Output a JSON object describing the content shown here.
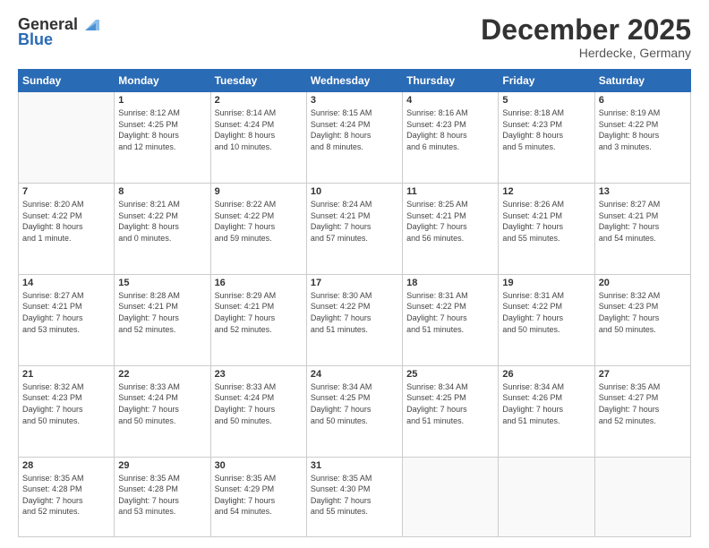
{
  "logo": {
    "general": "General",
    "blue": "Blue"
  },
  "header": {
    "month": "December 2025",
    "location": "Herdecke, Germany"
  },
  "weekdays": [
    "Sunday",
    "Monday",
    "Tuesday",
    "Wednesday",
    "Thursday",
    "Friday",
    "Saturday"
  ],
  "weeks": [
    [
      {
        "day": "",
        "info": ""
      },
      {
        "day": "1",
        "info": "Sunrise: 8:12 AM\nSunset: 4:25 PM\nDaylight: 8 hours\nand 12 minutes."
      },
      {
        "day": "2",
        "info": "Sunrise: 8:14 AM\nSunset: 4:24 PM\nDaylight: 8 hours\nand 10 minutes."
      },
      {
        "day": "3",
        "info": "Sunrise: 8:15 AM\nSunset: 4:24 PM\nDaylight: 8 hours\nand 8 minutes."
      },
      {
        "day": "4",
        "info": "Sunrise: 8:16 AM\nSunset: 4:23 PM\nDaylight: 8 hours\nand 6 minutes."
      },
      {
        "day": "5",
        "info": "Sunrise: 8:18 AM\nSunset: 4:23 PM\nDaylight: 8 hours\nand 5 minutes."
      },
      {
        "day": "6",
        "info": "Sunrise: 8:19 AM\nSunset: 4:22 PM\nDaylight: 8 hours\nand 3 minutes."
      }
    ],
    [
      {
        "day": "7",
        "info": "Sunrise: 8:20 AM\nSunset: 4:22 PM\nDaylight: 8 hours\nand 1 minute."
      },
      {
        "day": "8",
        "info": "Sunrise: 8:21 AM\nSunset: 4:22 PM\nDaylight: 8 hours\nand 0 minutes."
      },
      {
        "day": "9",
        "info": "Sunrise: 8:22 AM\nSunset: 4:22 PM\nDaylight: 7 hours\nand 59 minutes."
      },
      {
        "day": "10",
        "info": "Sunrise: 8:24 AM\nSunset: 4:21 PM\nDaylight: 7 hours\nand 57 minutes."
      },
      {
        "day": "11",
        "info": "Sunrise: 8:25 AM\nSunset: 4:21 PM\nDaylight: 7 hours\nand 56 minutes."
      },
      {
        "day": "12",
        "info": "Sunrise: 8:26 AM\nSunset: 4:21 PM\nDaylight: 7 hours\nand 55 minutes."
      },
      {
        "day": "13",
        "info": "Sunrise: 8:27 AM\nSunset: 4:21 PM\nDaylight: 7 hours\nand 54 minutes."
      }
    ],
    [
      {
        "day": "14",
        "info": "Sunrise: 8:27 AM\nSunset: 4:21 PM\nDaylight: 7 hours\nand 53 minutes."
      },
      {
        "day": "15",
        "info": "Sunrise: 8:28 AM\nSunset: 4:21 PM\nDaylight: 7 hours\nand 52 minutes."
      },
      {
        "day": "16",
        "info": "Sunrise: 8:29 AM\nSunset: 4:21 PM\nDaylight: 7 hours\nand 52 minutes."
      },
      {
        "day": "17",
        "info": "Sunrise: 8:30 AM\nSunset: 4:22 PM\nDaylight: 7 hours\nand 51 minutes."
      },
      {
        "day": "18",
        "info": "Sunrise: 8:31 AM\nSunset: 4:22 PM\nDaylight: 7 hours\nand 51 minutes."
      },
      {
        "day": "19",
        "info": "Sunrise: 8:31 AM\nSunset: 4:22 PM\nDaylight: 7 hours\nand 50 minutes."
      },
      {
        "day": "20",
        "info": "Sunrise: 8:32 AM\nSunset: 4:23 PM\nDaylight: 7 hours\nand 50 minutes."
      }
    ],
    [
      {
        "day": "21",
        "info": "Sunrise: 8:32 AM\nSunset: 4:23 PM\nDaylight: 7 hours\nand 50 minutes."
      },
      {
        "day": "22",
        "info": "Sunrise: 8:33 AM\nSunset: 4:24 PM\nDaylight: 7 hours\nand 50 minutes."
      },
      {
        "day": "23",
        "info": "Sunrise: 8:33 AM\nSunset: 4:24 PM\nDaylight: 7 hours\nand 50 minutes."
      },
      {
        "day": "24",
        "info": "Sunrise: 8:34 AM\nSunset: 4:25 PM\nDaylight: 7 hours\nand 50 minutes."
      },
      {
        "day": "25",
        "info": "Sunrise: 8:34 AM\nSunset: 4:25 PM\nDaylight: 7 hours\nand 51 minutes."
      },
      {
        "day": "26",
        "info": "Sunrise: 8:34 AM\nSunset: 4:26 PM\nDaylight: 7 hours\nand 51 minutes."
      },
      {
        "day": "27",
        "info": "Sunrise: 8:35 AM\nSunset: 4:27 PM\nDaylight: 7 hours\nand 52 minutes."
      }
    ],
    [
      {
        "day": "28",
        "info": "Sunrise: 8:35 AM\nSunset: 4:28 PM\nDaylight: 7 hours\nand 52 minutes."
      },
      {
        "day": "29",
        "info": "Sunrise: 8:35 AM\nSunset: 4:28 PM\nDaylight: 7 hours\nand 53 minutes."
      },
      {
        "day": "30",
        "info": "Sunrise: 8:35 AM\nSunset: 4:29 PM\nDaylight: 7 hours\nand 54 minutes."
      },
      {
        "day": "31",
        "info": "Sunrise: 8:35 AM\nSunset: 4:30 PM\nDaylight: 7 hours\nand 55 minutes."
      },
      {
        "day": "",
        "info": ""
      },
      {
        "day": "",
        "info": ""
      },
      {
        "day": "",
        "info": ""
      }
    ]
  ]
}
